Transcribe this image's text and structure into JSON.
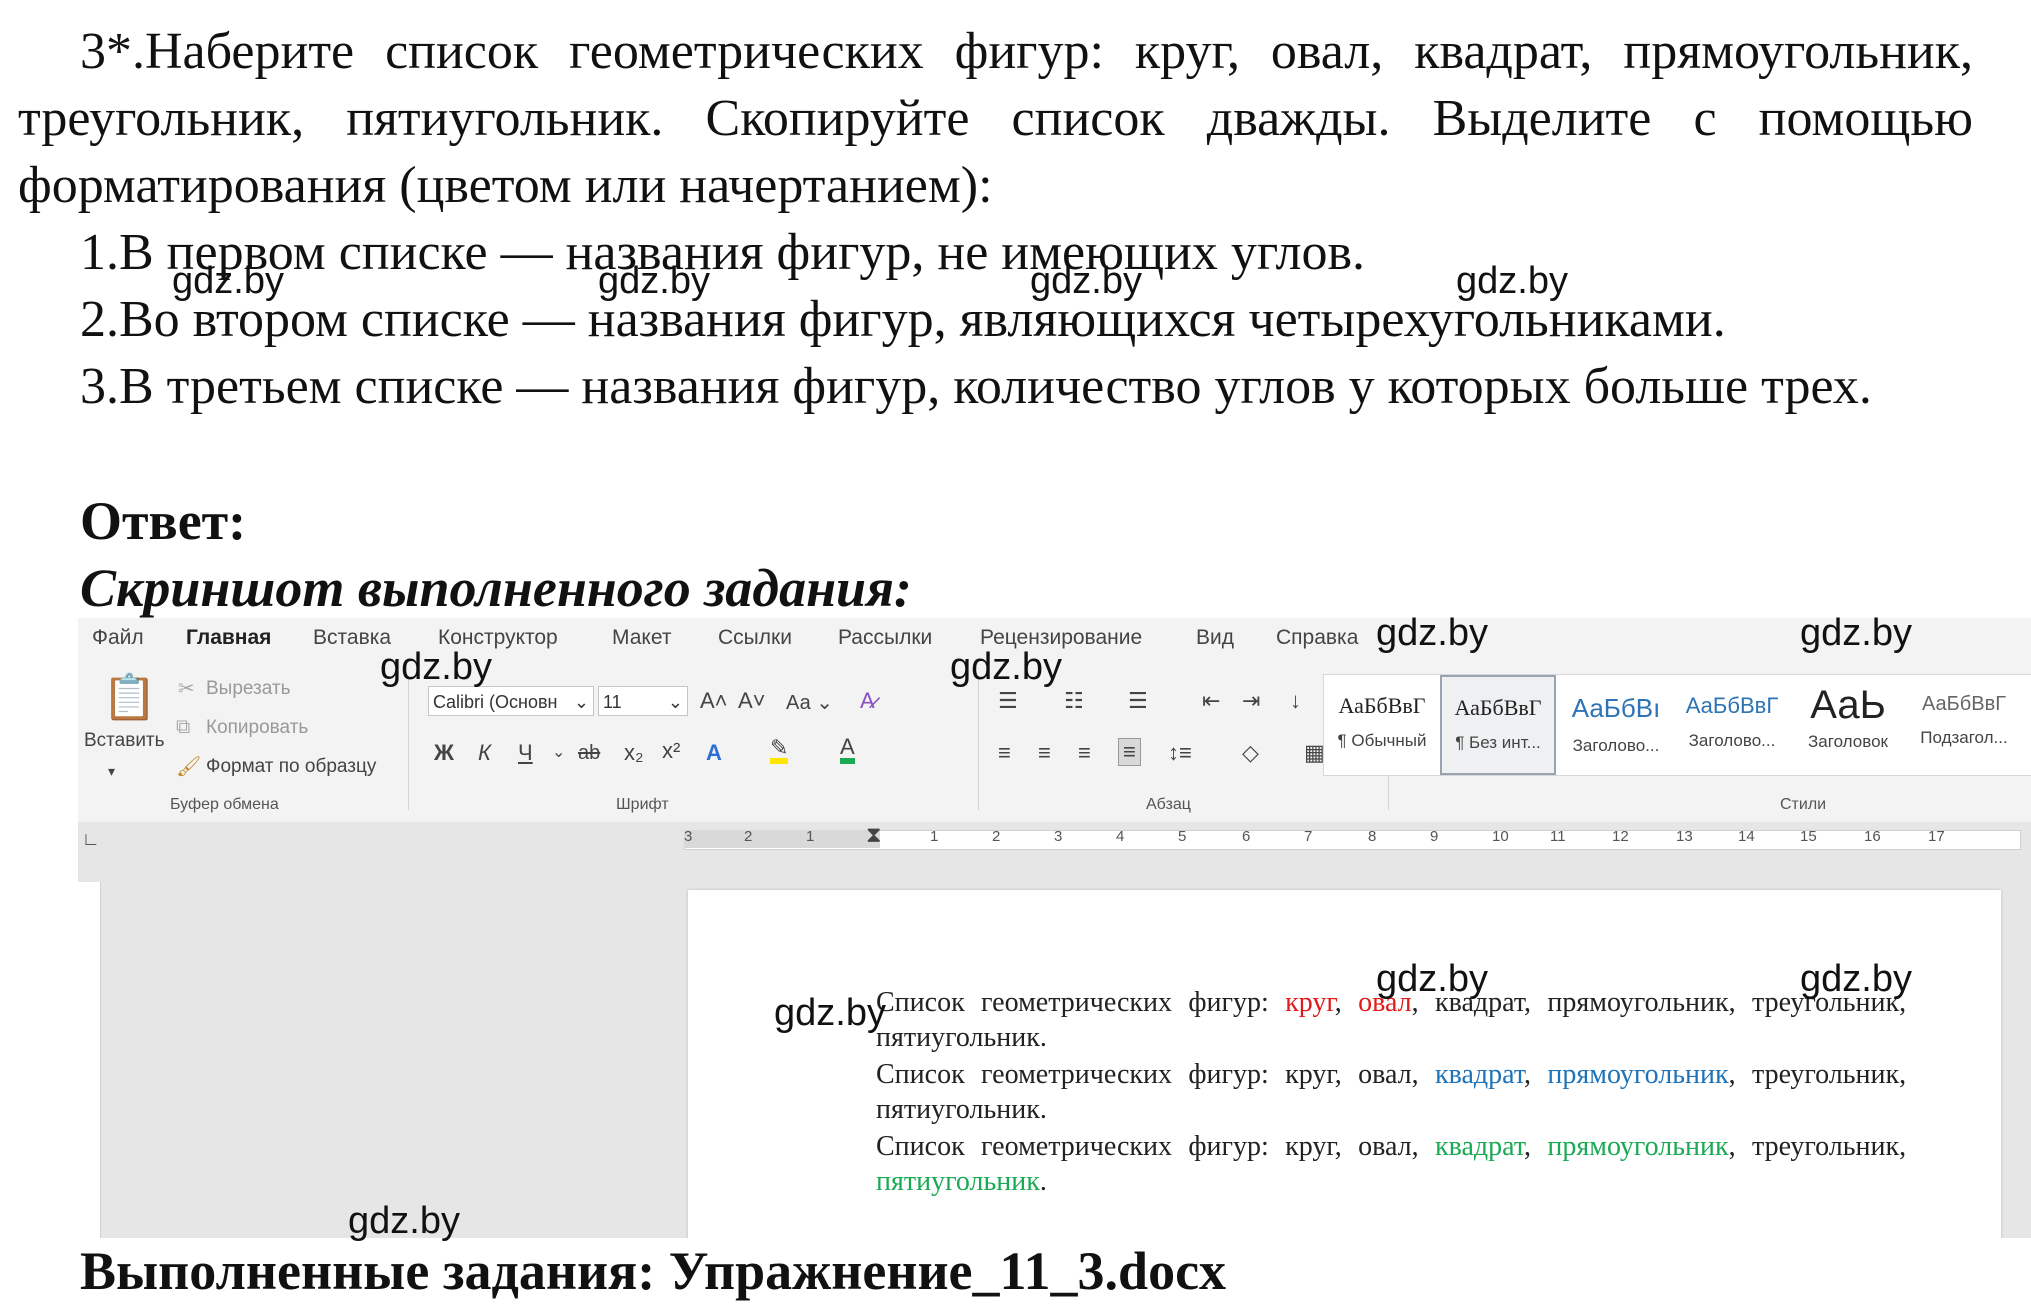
{
  "task": {
    "intro": "3*.Наберите список геометрических фигур: круг, овал, квадрат, прямоугольник, треугольник, пятиугольник. Скопируйте список дважды. Выделите с помощью форматирования (цветом или начертанием):",
    "item1": "1.В первом списке — названия фигур, не имеющих углов.",
    "item2": "2.Во втором списке — названия фигур, являющихся четырехугольниками.",
    "item3": "3.В третьем списке — названия фигур, количество углов у которых больше трех."
  },
  "answer_label": "Ответ:",
  "screenshot_title": "Скриншот выполненного задания:",
  "done_label": "Выполненные задания: Упражнение_11_3.docx",
  "watermark": "gdz.by",
  "word": {
    "menu": [
      "Файл",
      "Главная",
      "Вставка",
      "Конструктор",
      "Макет",
      "Ссылки",
      "Рассылки",
      "Рецензирование",
      "Вид",
      "Справка"
    ],
    "clipboard": {
      "paste": "Вставить",
      "cut": "Вырезать",
      "copy": "Копировать",
      "format_painter": "Формат по образцу",
      "group": "Буфер обмена"
    },
    "font": {
      "name": "Calibri (Основн",
      "size": "11",
      "group": "Шрифт",
      "case": "Аа",
      "bold": "Ж",
      "italic": "К",
      "underline": "Ч",
      "strike": "ab"
    },
    "paragraph": {
      "group": "Абзац"
    },
    "styles": {
      "group": "Стили",
      "items": [
        {
          "sample": "АаБбВвГ",
          "name": "¶ Обычный"
        },
        {
          "sample": "АаБбВвГ",
          "name": "¶ Без инт..."
        },
        {
          "sample": "АаБбВı",
          "name": "Заголово..."
        },
        {
          "sample": "АаБбВвГ",
          "name": "Заголово..."
        },
        {
          "sample": "АаЬ",
          "name": "Заголовок"
        },
        {
          "sample": "АаБбВвГ",
          "name": "Подзагол..."
        }
      ]
    },
    "ruler_numbers": [
      "3",
      "2",
      "1",
      "1",
      "2",
      "3",
      "4",
      "5",
      "6",
      "7",
      "8",
      "9",
      "10",
      "11",
      "12",
      "13",
      "14",
      "15",
      "16",
      "17"
    ],
    "doc": {
      "lead": "Список геометрических фигур:",
      "shapes": [
        "круг",
        "овал",
        "квадрат",
        "прямоугольник",
        "треугольник",
        "пятиугольник"
      ]
    }
  },
  "colors": {
    "red": "#e01b1b",
    "blue": "#1e73b8",
    "green": "#1aaa55"
  }
}
